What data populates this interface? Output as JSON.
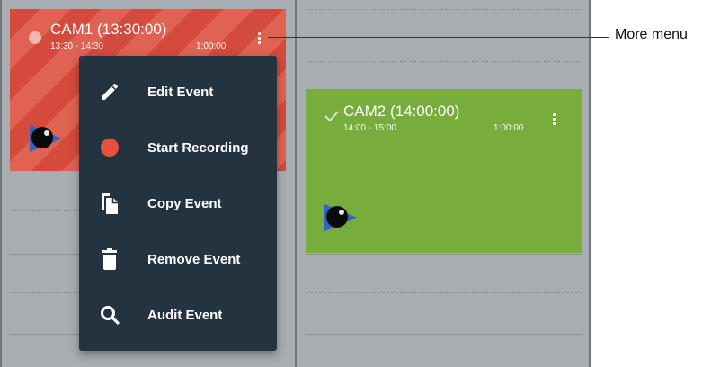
{
  "events": [
    {
      "title": "CAM1 (13:30:00)",
      "time_range": "13:30 - 14:30",
      "duration": "1:00:00",
      "color": "#d44a3d"
    },
    {
      "title": "CAM2 (14:00:00)",
      "time_range": "14:00 - 15:00",
      "duration": "1:00:00",
      "color": "#78ad3d"
    }
  ],
  "context_menu": {
    "items": [
      {
        "label": "Edit Event",
        "icon": "pencil-icon"
      },
      {
        "label": "Start Recording",
        "icon": "record-dot-icon"
      },
      {
        "label": "Copy Event",
        "icon": "copy-icon"
      },
      {
        "label": "Remove Event",
        "icon": "trash-icon"
      },
      {
        "label": "Audit Event",
        "icon": "search-icon"
      }
    ]
  },
  "callout": {
    "label": "More menu"
  },
  "colors": {
    "menu_bg": "#243340",
    "record": "#e8513f",
    "grid_bg": "#a7adb0"
  }
}
